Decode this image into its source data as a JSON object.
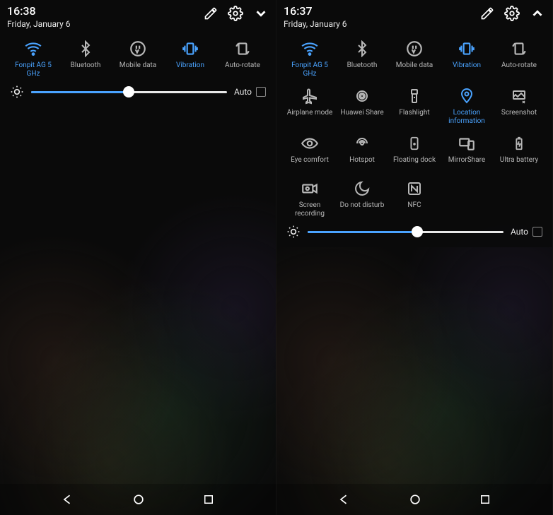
{
  "colors": {
    "accent": "#4aa3ff",
    "text": "#e8e8e8",
    "muted": "#b8b8b8"
  },
  "panels": {
    "left": {
      "time": "16:38",
      "date": "Friday, January 6",
      "expand_direction": "down",
      "brightness": {
        "value": 50,
        "auto_label": "Auto",
        "auto_checked": false
      },
      "tiles": [
        {
          "id": "wifi",
          "label": "Fonpit AG 5 GHz",
          "active": true
        },
        {
          "id": "bluetooth",
          "label": "Bluetooth",
          "active": false
        },
        {
          "id": "mobile-data",
          "label": "Mobile data",
          "active": false
        },
        {
          "id": "vibration",
          "label": "Vibration",
          "active": true
        },
        {
          "id": "auto-rotate",
          "label": "Auto-rotate",
          "active": false
        }
      ]
    },
    "right": {
      "time": "16:37",
      "date": "Friday, January 6",
      "expand_direction": "up",
      "brightness": {
        "value": 56,
        "auto_label": "Auto",
        "auto_checked": false
      },
      "tiles": [
        {
          "id": "wifi",
          "label": "Fonpit AG 5 GHz",
          "active": true
        },
        {
          "id": "bluetooth",
          "label": "Bluetooth",
          "active": false
        },
        {
          "id": "mobile-data",
          "label": "Mobile data",
          "active": false
        },
        {
          "id": "vibration",
          "label": "Vibration",
          "active": true
        },
        {
          "id": "auto-rotate",
          "label": "Auto-rotate",
          "active": false
        },
        {
          "id": "airplane-mode",
          "label": "Airplane mode",
          "active": false
        },
        {
          "id": "huawei-share",
          "label": "Huawei Share",
          "active": false
        },
        {
          "id": "flashlight",
          "label": "Flashlight",
          "active": false
        },
        {
          "id": "location",
          "label": "Location information",
          "active": true
        },
        {
          "id": "screenshot",
          "label": "Screenshot",
          "active": false
        },
        {
          "id": "eye-comfort",
          "label": "Eye comfort",
          "active": false
        },
        {
          "id": "hotspot",
          "label": "Hotspot",
          "active": false
        },
        {
          "id": "floating-dock",
          "label": "Floating dock",
          "active": false
        },
        {
          "id": "mirrorshare",
          "label": "MirrorShare",
          "active": false
        },
        {
          "id": "ultra-battery",
          "label": "Ultra battery",
          "active": false
        },
        {
          "id": "screen-recording",
          "label": "Screen recording",
          "active": false
        },
        {
          "id": "do-not-disturb",
          "label": "Do not disturb",
          "active": false
        },
        {
          "id": "nfc",
          "label": "NFC",
          "active": false
        }
      ]
    }
  },
  "nav": {
    "back": "back",
    "home": "home",
    "recent": "recent"
  }
}
